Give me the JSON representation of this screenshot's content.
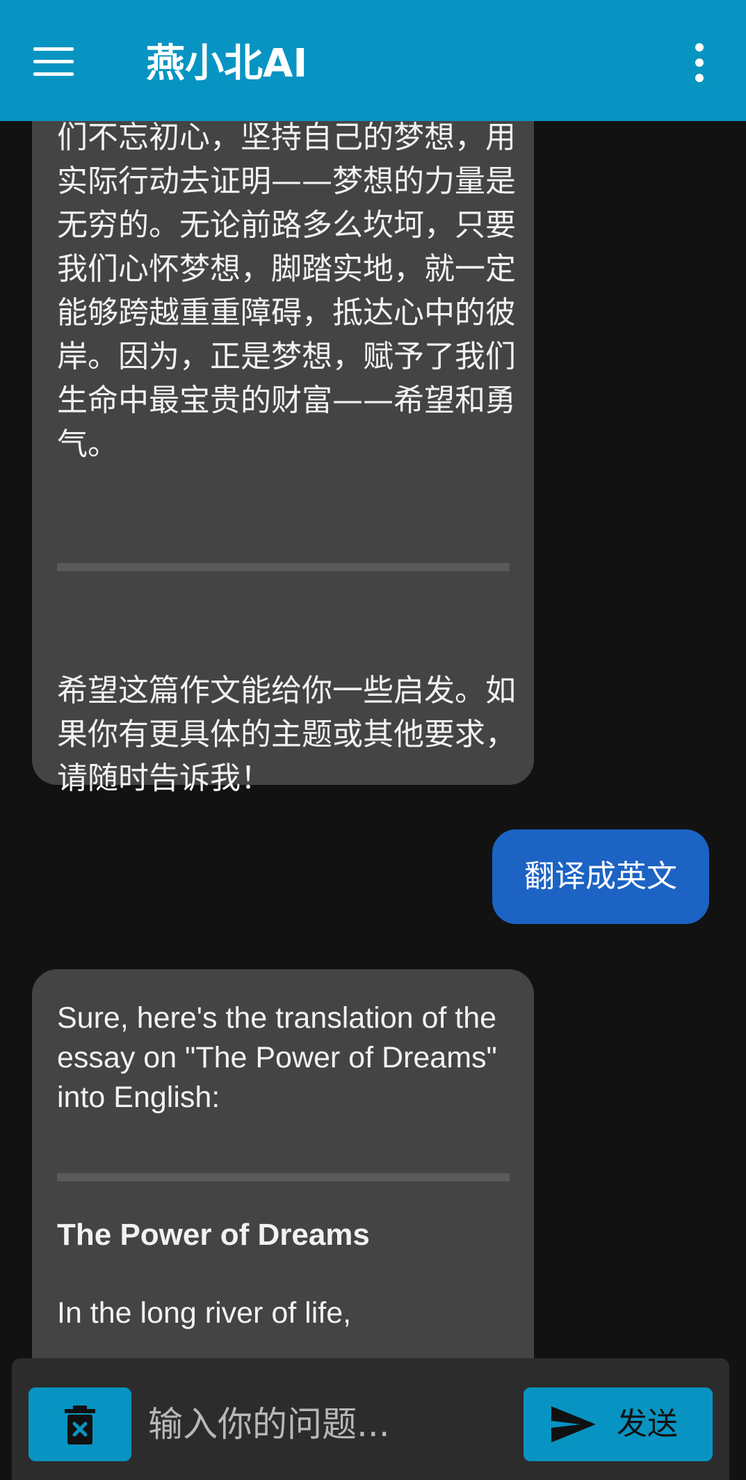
{
  "app": {
    "title": "燕小北AI"
  },
  "icons": {
    "menu": "hamburger-menu-icon",
    "more": "more-vertical-icon",
    "delete": "trash-icon",
    "send": "send-icon"
  },
  "colors": {
    "app_bar": "#0894c2",
    "background": "#121212",
    "ai_bubble": "#444444",
    "user_bubble": "#1c63c4",
    "input_bar": "#2c2c2c"
  },
  "messages": [
    {
      "role": "assistant",
      "paragraphs": [
        "们不忘初心，坚持自己的梦想，用实际行动去证明——梦想的力量是无穷的。无论前路多么坎坷，只要我们心怀梦想，脚踏实地，就一定能够跨越重重障碍，抵达心中的彼岸。因为，正是梦想，赋予了我们生命中最宝贵的财富——希望和勇气。",
        "希望这篇作文能给你一些启发。如果你有更具体的主题或其他要求，请随时告诉我！"
      ]
    },
    {
      "role": "user",
      "text": "翻译成英文"
    },
    {
      "role": "assistant",
      "intro": "Sure, here's the translation of the essay on \"The Power of Dreams\" into English:",
      "heading": "The Power of Dreams",
      "body": "In the long river of life,"
    }
  ],
  "input": {
    "placeholder": "输入你的问题...",
    "value": "",
    "send_label": "发送"
  }
}
